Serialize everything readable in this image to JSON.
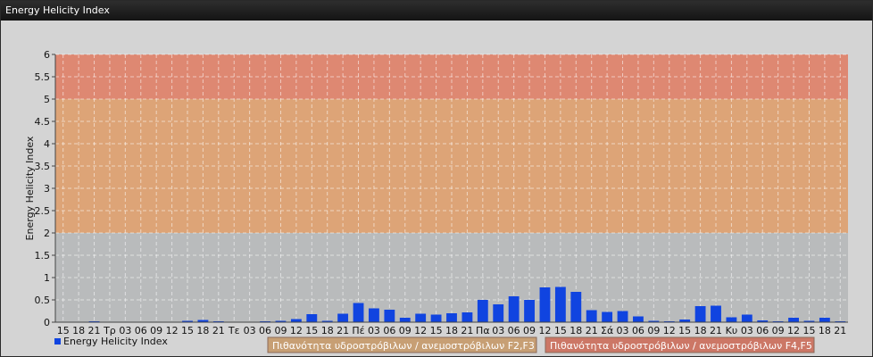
{
  "window": {
    "title": "Energy Helicity Index"
  },
  "colors": {
    "panel_bg": "#d4d4d4",
    "plot_bg": "#b9bbbc",
    "band_f2f3": "#dda477",
    "band_f4f5": "#de8872",
    "bar": "#1044e0",
    "legend_f2f3_bg": "#c79f74",
    "legend_f4f5_bg": "#cc7766"
  },
  "chart_data": {
    "type": "bar",
    "ylabel": "Energy Helicity Index",
    "ylim": [
      0,
      6
    ],
    "yticks": [
      "0",
      "0.5",
      "1",
      "1.5",
      "2",
      "2.5",
      "3",
      "3.5",
      "4",
      "4.5",
      "5",
      "5.5",
      "6"
    ],
    "categories": [
      "15",
      "18",
      "21",
      "Τρ",
      "03",
      "06",
      "09",
      "12",
      "15",
      "18",
      "21",
      "Τε",
      "03",
      "06",
      "09",
      "12",
      "15",
      "18",
      "21",
      "Πέ",
      "03",
      "06",
      "09",
      "12",
      "15",
      "18",
      "21",
      "Πα",
      "03",
      "06",
      "09",
      "12",
      "15",
      "18",
      "21",
      "Σά",
      "03",
      "06",
      "09",
      "12",
      "15",
      "18",
      "21",
      "Κυ",
      "03",
      "06",
      "09",
      "12",
      "15",
      "18",
      "21"
    ],
    "series": [
      {
        "name": "Energy Helicity Index",
        "values": [
          0.01,
          0.01,
          0.02,
          0.01,
          0.01,
          0.01,
          0.01,
          0.01,
          0.03,
          0.05,
          0.02,
          0.01,
          0.01,
          0.02,
          0.03,
          0.07,
          0.18,
          0.03,
          0.19,
          0.43,
          0.31,
          0.28,
          0.1,
          0.19,
          0.17,
          0.2,
          0.22,
          0.5,
          0.4,
          0.58,
          0.5,
          0.78,
          0.79,
          0.68,
          0.27,
          0.23,
          0.25,
          0.13,
          0.03,
          0.02,
          0.06,
          0.36,
          0.37,
          0.11,
          0.17,
          0.04,
          0.02,
          0.1,
          0.03,
          0.1,
          0.02
        ]
      }
    ],
    "bands": [
      {
        "label": "Πιθανότητα υδροστρόβιλων / ανεμοστρόβιλων F2,F3",
        "from": 2,
        "to": 5
      },
      {
        "label": "Πιθανότητα υδροστρόβιλων / ανεμοστρόβιλων F4,F5",
        "from": 5,
        "to": 6
      }
    ],
    "grid": true,
    "legend_position": "bottom"
  }
}
